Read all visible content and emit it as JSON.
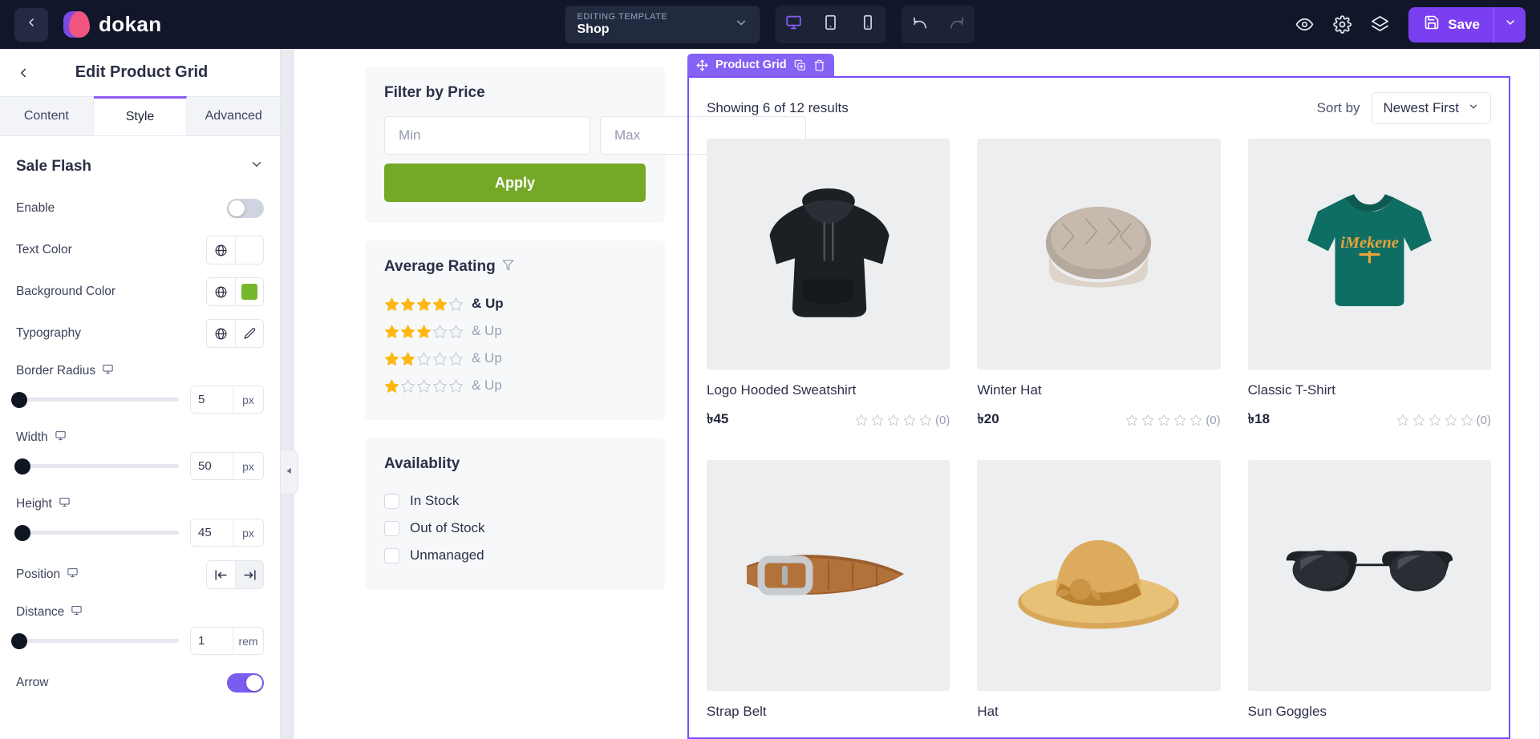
{
  "topbar": {
    "back_icon": "chevron-left-icon",
    "brand": "dokan",
    "template": {
      "eyebrow": "EDITING TEMPLATE",
      "value": "Shop",
      "caret_icon": "chevron-down-icon"
    },
    "devices": [
      {
        "name": "desktop",
        "icon": "desktop-icon",
        "active": true
      },
      {
        "name": "tablet",
        "icon": "tablet-icon",
        "active": false
      },
      {
        "name": "mobile",
        "icon": "mobile-icon",
        "active": false
      }
    ],
    "history": [
      {
        "name": "undo",
        "icon": "undo-icon",
        "enabled": true
      },
      {
        "name": "redo",
        "icon": "redo-icon",
        "enabled": false
      }
    ],
    "right_icons": [
      "eye-icon",
      "gear-icon",
      "layers-icon"
    ],
    "save_label": "Save",
    "save_icon": "floppy-disk-icon",
    "accent_purple": "#7b3ff2",
    "bar_bg": "#11162a"
  },
  "sidebar": {
    "back_icon": "chevron-left-icon",
    "title": "Edit Product Grid",
    "tabs": [
      {
        "label": "Content",
        "active": false
      },
      {
        "label": "Style",
        "active": true
      },
      {
        "label": "Advanced",
        "active": false
      }
    ],
    "section": {
      "title": "Sale Flash",
      "collapse_icon": "chevron-down-icon"
    },
    "controls": [
      {
        "label": "Enable",
        "type": "toggle",
        "value": "off"
      },
      {
        "label": "Text Color",
        "type": "color",
        "swatch": ""
      },
      {
        "label": "Background Color",
        "type": "color",
        "swatch": "#76b82a"
      },
      {
        "label": "Typography",
        "type": "typography"
      },
      {
        "label": "Border Radius",
        "type": "slider",
        "value": "5",
        "unit": "px",
        "percent": 2
      },
      {
        "label": "Width",
        "type": "slider",
        "value": "50",
        "unit": "px",
        "percent": 4
      },
      {
        "label": "Height",
        "type": "slider",
        "value": "45",
        "unit": "px",
        "percent": 4
      },
      {
        "label": "Position",
        "type": "segment",
        "options": [
          "align-left",
          "align-right"
        ],
        "selected": "align-right"
      },
      {
        "label": "Distance",
        "type": "slider",
        "value": "1",
        "unit": "rem",
        "percent": 2
      },
      {
        "label": "Arrow",
        "type": "toggle",
        "value": "on"
      }
    ]
  },
  "canvas": {
    "collapse_icon": "caret-left-icon",
    "filter_price": {
      "title": "Filter by Price",
      "min_placeholder": "Min",
      "max_placeholder": "Max",
      "min_value": "",
      "max_value": "",
      "apply_label": "Apply",
      "apply_color": "#76a828"
    },
    "average_rating": {
      "title": "Average Rating",
      "filter_icon": "funnel-icon",
      "rows": [
        {
          "filled": 4,
          "label": "& Up",
          "highlight": true
        },
        {
          "filled": 3,
          "label": "& Up",
          "highlight": false
        },
        {
          "filled": 2,
          "label": "& Up",
          "highlight": false
        },
        {
          "filled": 1,
          "label": "& Up",
          "highlight": false
        }
      ]
    },
    "availability": {
      "title": "Availablity",
      "options": [
        {
          "label": "In Stock",
          "checked": false
        },
        {
          "label": "Out of Stock",
          "checked": false
        },
        {
          "label": "Unmanaged",
          "checked": false
        }
      ]
    },
    "product_grid": {
      "badge_label": "Product Grid",
      "badge_icons": [
        "move-icon",
        "duplicate-icon",
        "trash-icon"
      ],
      "badge_color": "#8561f5",
      "showing": "Showing 6 of 12 results",
      "sort_label": "Sort by",
      "sort_value": "Newest First",
      "sort_caret": "chevron-down-icon",
      "products": [
        {
          "name": "Logo Hooded Sweatshirt",
          "price": "৳45",
          "rating": 0,
          "reviews": "(0)",
          "image": "black-hoodie"
        },
        {
          "name": "Winter Hat",
          "price": "৳20",
          "rating": 0,
          "reviews": "(0)",
          "image": "knit-beanie"
        },
        {
          "name": "Classic T-Shirt",
          "price": "৳18",
          "rating": 0,
          "reviews": "(0)",
          "image": "teal-tshirt"
        },
        {
          "name": "Strap Belt",
          "price": "",
          "rating": 0,
          "reviews": "",
          "image": "brown-belt"
        },
        {
          "name": "Hat",
          "price": "",
          "rating": 0,
          "reviews": "",
          "image": "straw-hat"
        },
        {
          "name": "Sun Goggles",
          "price": "",
          "rating": 0,
          "reviews": "",
          "image": "sunglasses"
        }
      ]
    }
  }
}
